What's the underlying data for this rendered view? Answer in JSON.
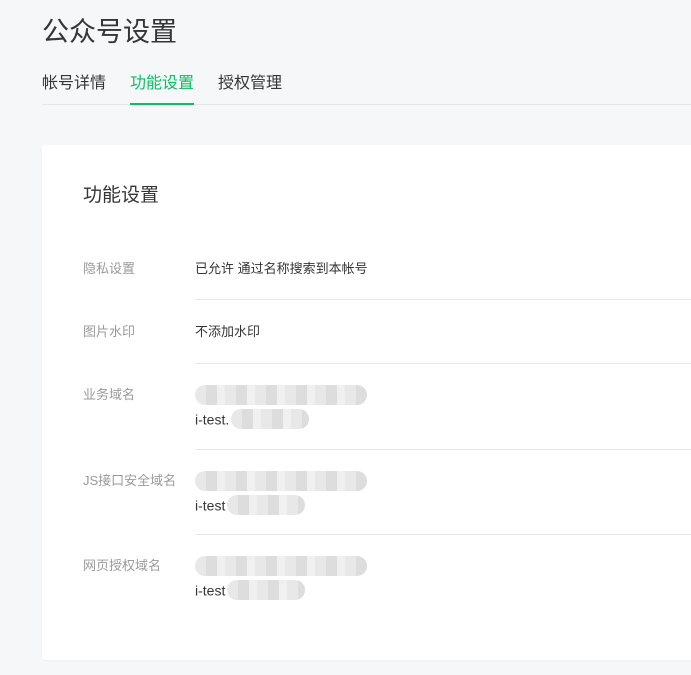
{
  "page": {
    "title": "公众号设置"
  },
  "tabs": [
    {
      "label": "帐号详情",
      "active": false
    },
    {
      "label": "功能设置",
      "active": true
    },
    {
      "label": "授权管理",
      "active": false
    }
  ],
  "colors": {
    "accent": "#07c160",
    "background": "#f6f7f9",
    "label": "#9a9a9a"
  },
  "card": {
    "title": "功能设置",
    "rows": [
      {
        "label": "隐私设置",
        "value": "已允许 通过名称搜索到本帐号"
      },
      {
        "label": "图片水印",
        "value": "不添加水印"
      },
      {
        "label": "业务域名",
        "domain_prefix": "i-test."
      },
      {
        "label": "JS接口安全域名",
        "domain_prefix": "i-test"
      },
      {
        "label": "网页授权域名",
        "domain_prefix": "i-test"
      }
    ]
  }
}
